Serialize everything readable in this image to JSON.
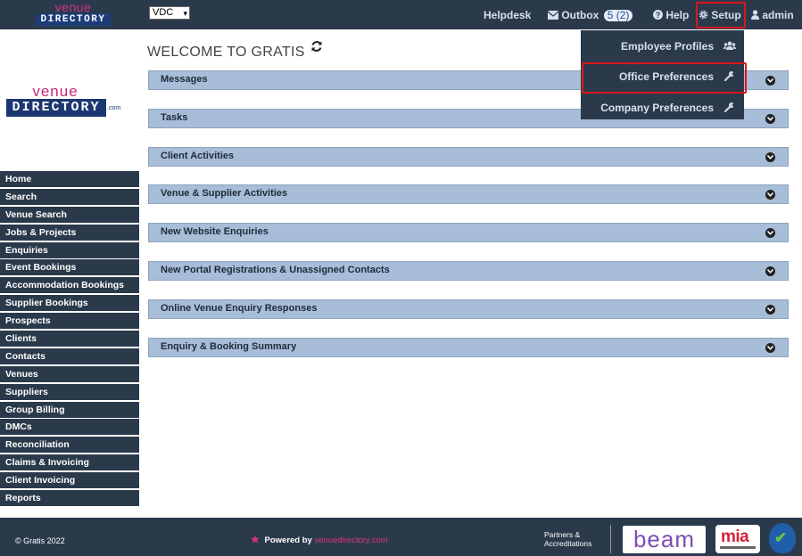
{
  "header": {
    "logo_top": "venue",
    "logo_bottom": "DIRECTORY",
    "office_select": "VDC",
    "helpdesk": "Helpdesk",
    "outbox": "Outbox",
    "outbox_count": "5 (2)",
    "help": "Help",
    "setup": "Setup",
    "admin": "admin"
  },
  "setup_menu": {
    "items": [
      {
        "label": "Employee Profiles",
        "icon": "users-icon"
      },
      {
        "label": "Office Preferences",
        "icon": "wrench-icon"
      },
      {
        "label": "Company Preferences",
        "icon": "wrench-icon"
      }
    ]
  },
  "side_logo": {
    "top": "venue",
    "bottom": "DIRECTORY",
    "suffix": ".com"
  },
  "sidebar": {
    "items": [
      "Home",
      "Search",
      "Venue Search",
      "Jobs & Projects",
      "Enquiries",
      "Event Bookings",
      "Accommodation Bookings",
      "Supplier Bookings",
      "Prospects",
      "Clients",
      "Contacts",
      "Venues",
      "Suppliers",
      "Group Billing",
      "DMCs",
      "Reconciliation",
      "Claims & Invoicing",
      "Client Invoicing",
      "Reports"
    ]
  },
  "main": {
    "welcome": "WELCOME TO GRATIS",
    "panels": [
      "Messages",
      "Tasks",
      "Client Activities",
      "Venue & Supplier Activities",
      "New Website Enquiries",
      "New Portal Registrations & Unassigned Contacts",
      "Online Venue Enquiry Responses",
      "Enquiry & Booking Summary"
    ]
  },
  "footer": {
    "copyright": "© Gratis 2022",
    "powered_by": "Powered by",
    "powered_site": "venuedirectory.com",
    "partners_line1": "Partners &",
    "partners_line2": "Accreditations",
    "beam": "beam",
    "mia": "mia"
  },
  "colors": {
    "navbar": "#2b3a4b",
    "panel": "#a7bdd8",
    "highlight": "#d9161c",
    "brand_pink": "#e0337e"
  }
}
